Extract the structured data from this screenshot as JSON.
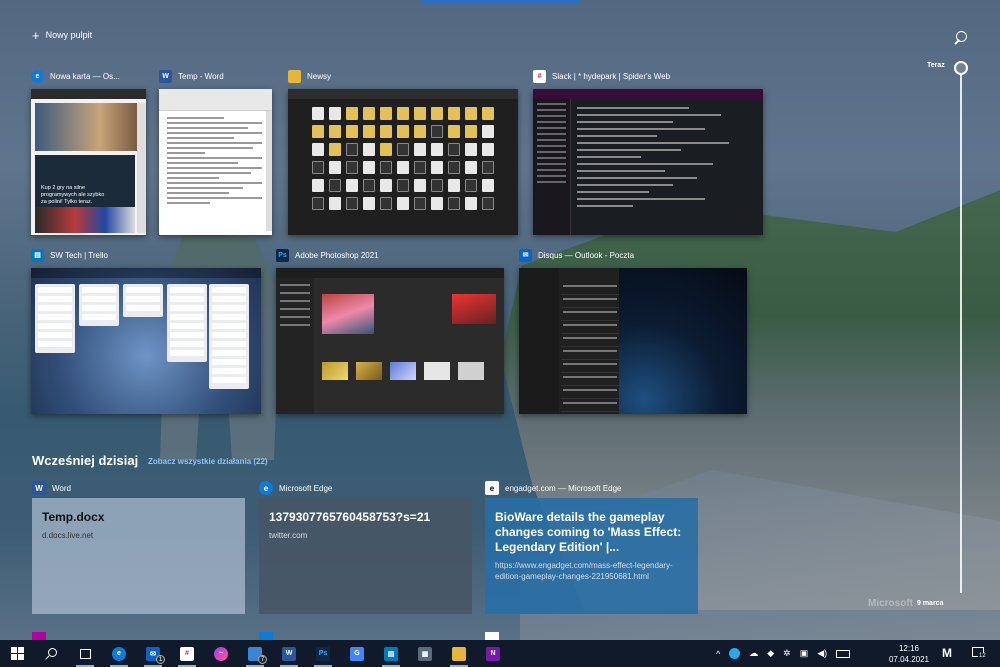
{
  "top": {
    "new_desktop_label": "Nowy pulpit"
  },
  "timeline": {
    "now_label": "Teraz",
    "date_label": "9 marca"
  },
  "windows": [
    {
      "title": "Nowa karta — Os...",
      "app": "edge",
      "thumb_caption": "Kup 2 gry na silne programywych ale szybko za polini! Tylko teraz."
    },
    {
      "title": "Temp - Word",
      "app": "word"
    },
    {
      "title": "Newsy",
      "app": "explorer"
    },
    {
      "title": "Slack | * hydepark | Spider's Web",
      "app": "slack"
    },
    {
      "title": "SW Tech | Trello",
      "app": "trello"
    },
    {
      "title": "Adobe Photoshop 2021",
      "app": "photoshop"
    },
    {
      "title": "Disqus — Outlook - Poczta",
      "app": "outlook"
    }
  ],
  "earlier": {
    "title": "Wcześniej dzisiaj",
    "see_all": "Zobacz wszystkie działania (22)",
    "cards": [
      {
        "app": "Word",
        "title": "Temp.docx",
        "subtitle": "d.docs.live.net"
      },
      {
        "app": "Microsoft Edge",
        "title": "1379307765760458753?s=21",
        "subtitle": "twitter.com"
      },
      {
        "app": "engadget.com — Microsoft Edge",
        "title": "BioWare details the gameplay changes coming to 'Mass Effect: Legendary Edition' |...",
        "subtitle": "https://www.engadget.com/mass-effect-legendary-edition-gameplay-changes-221950681.html"
      }
    ]
  },
  "watermark": "Microsoft",
  "taskbar": {
    "badges": {
      "mail": "1",
      "docs": "7"
    },
    "clock_time": "12:16",
    "clock_date": "07.04.2021",
    "notification_count": "12",
    "show_desktop_glyph": "M"
  },
  "icons": {
    "edge": "edge-icon",
    "word": "word-icon",
    "explorer": "folder-icon",
    "slack": "slack-icon",
    "trello": "trello-icon",
    "photoshop": "photoshop-icon",
    "outlook": "outlook-icon",
    "engadget": "engadget-icon"
  },
  "colors": {
    "accent": "#2b6fc2",
    "word": "#2b579a",
    "edge": "#0f7ad8",
    "photoshop": "#0e2744",
    "trello": "#0079bf",
    "outlook": "#0a64c4",
    "link": "#8cc4ff"
  }
}
